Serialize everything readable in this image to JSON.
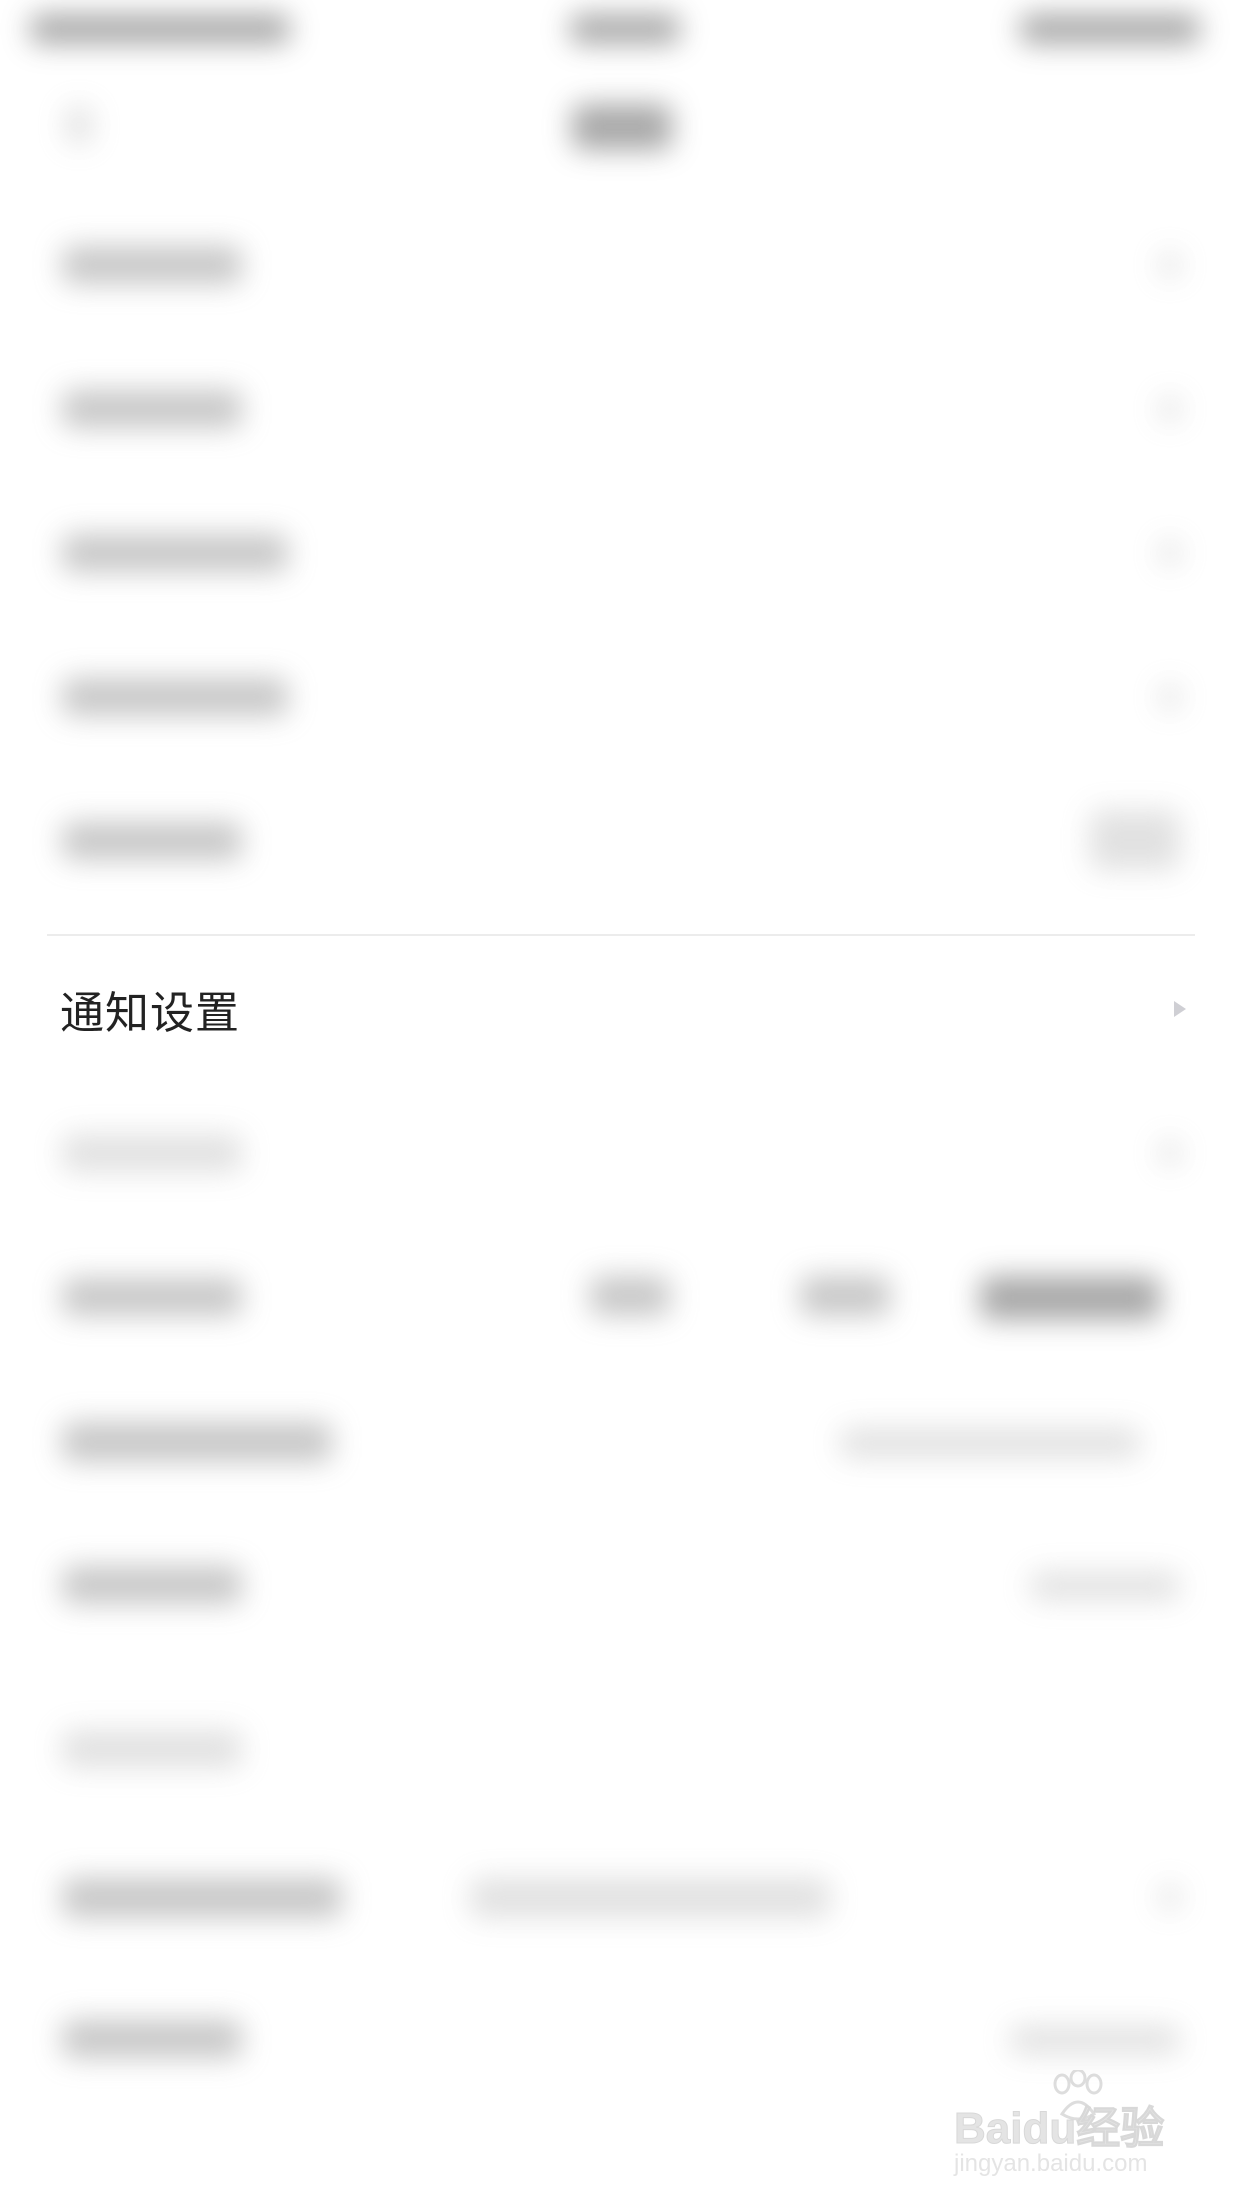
{
  "focused_row": {
    "label": "通知设置"
  },
  "watermark": {
    "line1": "Baidu经验",
    "line2": "jingyan.baidu.com"
  },
  "colors": {
    "background": "#ffffff",
    "text": "#222222",
    "chevron": "#cfcfd4",
    "divider": "#ececec"
  }
}
